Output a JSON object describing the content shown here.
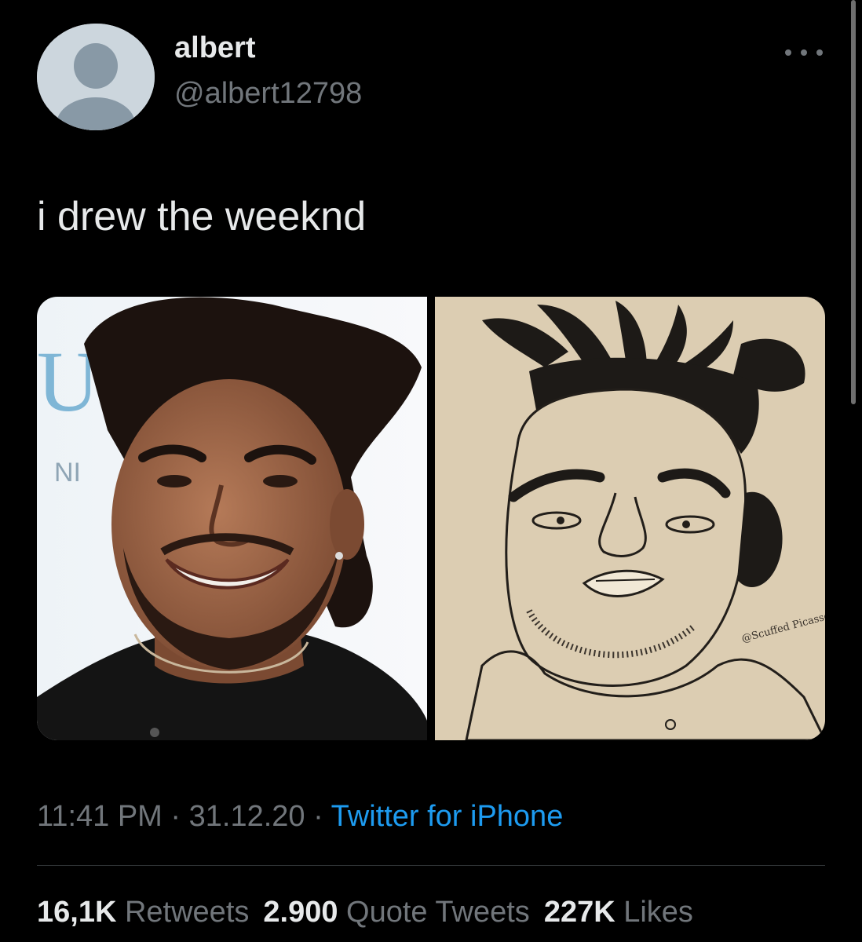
{
  "user": {
    "display_name": "albert",
    "handle": "@albert12798"
  },
  "tweet": {
    "text": "i drew the weeknd",
    "time": "11:41 PM",
    "date": "31.12.20",
    "separator": "·",
    "source": "Twitter for iPhone"
  },
  "media": {
    "left_sign_text": "U",
    "left_sign_subtext": "NI",
    "right_signature": "@Scuffed Picasso"
  },
  "stats": {
    "retweets_count": "16,1K",
    "retweets_label": "Retweets",
    "quotes_count": "2.900",
    "quotes_label": "Quote Tweets",
    "likes_count": "227K",
    "likes_label": "Likes"
  },
  "icons": {
    "avatar": "default-avatar-icon",
    "more": "more-dots-icon"
  },
  "colors": {
    "background": "#000000",
    "text_primary": "#e7e9ea",
    "text_secondary": "#71767b",
    "link": "#1d9bf0"
  }
}
